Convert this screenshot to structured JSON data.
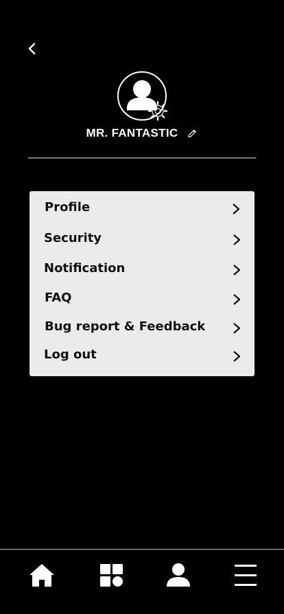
{
  "header": {
    "back_icon": "chevron-left-icon"
  },
  "profile": {
    "avatar_icon": "user-avatar-icon",
    "settings_icon": "gear-icon",
    "name": "MR. FANTASTIC",
    "edit_icon": "pencil-icon"
  },
  "menu": {
    "items": [
      {
        "label": "Profile",
        "icon": "chevron-right-icon"
      },
      {
        "label": "Security",
        "icon": "chevron-right-icon"
      },
      {
        "label": "Notification",
        "icon": "chevron-right-icon"
      },
      {
        "label": "FAQ",
        "icon": "chevron-right-icon"
      },
      {
        "label": "Bug report & Feedback",
        "icon": "chevron-right-icon"
      },
      {
        "label": "Log out",
        "icon": "chevron-right-icon"
      }
    ]
  },
  "tabbar": {
    "tabs": [
      {
        "icon": "home-icon"
      },
      {
        "icon": "grid-icon"
      },
      {
        "icon": "person-icon"
      },
      {
        "icon": "hamburger-menu-icon"
      }
    ]
  },
  "colors": {
    "background": "#000000",
    "menu_panel": "#ebebeb",
    "text_dark": "#111111",
    "text_light": "#ffffff"
  }
}
